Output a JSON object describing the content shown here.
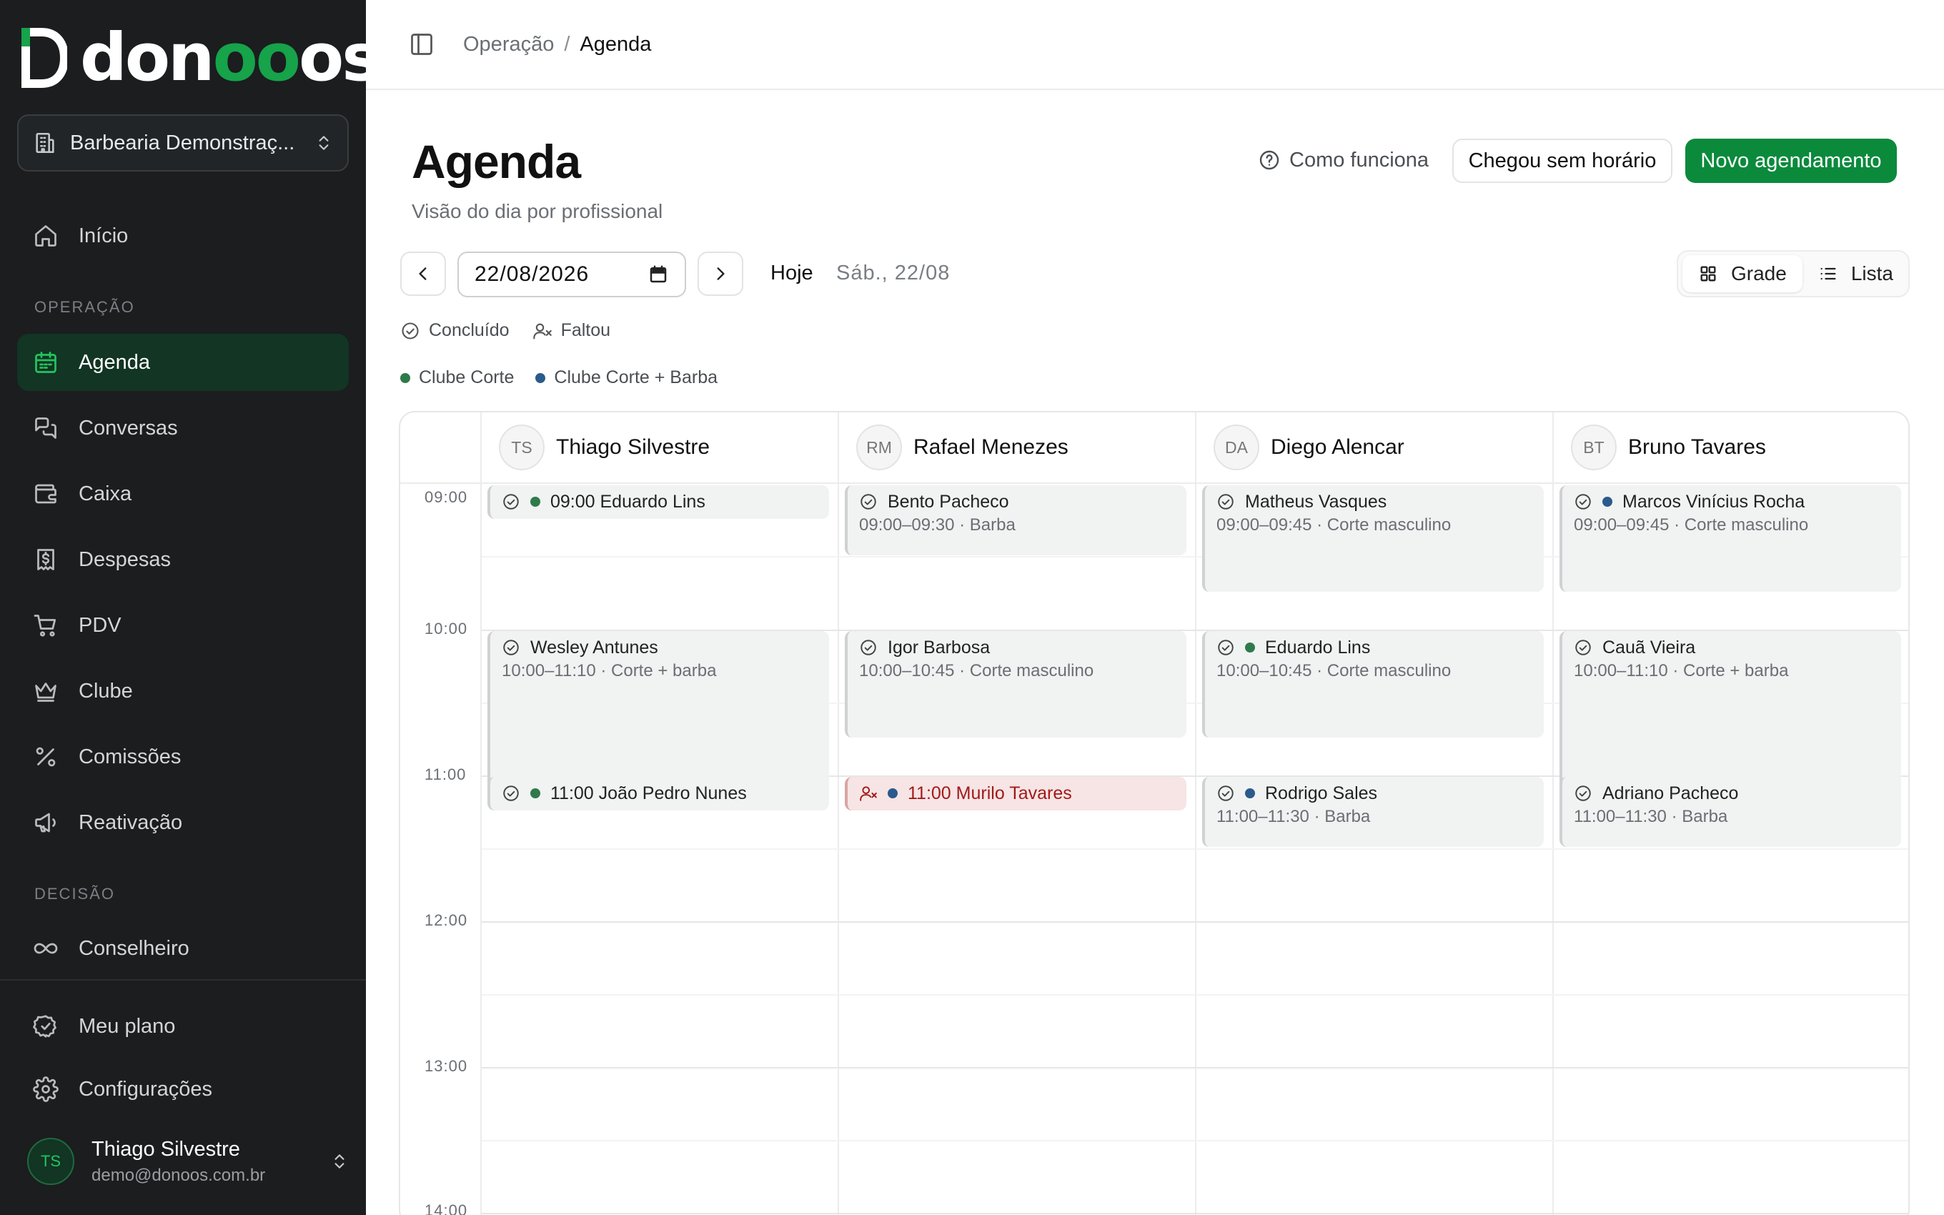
{
  "app": {
    "brand_prefix": "don",
    "brand_suffix": "os",
    "brand_accent": "oo",
    "brand_color": "#16a34a"
  },
  "sidebar": {
    "org_name": "Barbearia Demonstraç...",
    "items_top": [
      {
        "label": "Início",
        "icon": "home-icon"
      }
    ],
    "section_operacao": "OPERAÇÃO",
    "items_operacao": [
      {
        "label": "Agenda",
        "icon": "calendar-icon",
        "active": true
      },
      {
        "label": "Conversas",
        "icon": "chat-icon"
      },
      {
        "label": "Caixa",
        "icon": "wallet-icon"
      },
      {
        "label": "Despesas",
        "icon": "receipt-icon"
      },
      {
        "label": "PDV",
        "icon": "cart-icon"
      },
      {
        "label": "Clube",
        "icon": "crown-icon"
      },
      {
        "label": "Comissões",
        "icon": "percent-icon"
      },
      {
        "label": "Reativação",
        "icon": "megaphone-icon"
      }
    ],
    "section_decisao": "DECISÃO",
    "items_decisao": [
      {
        "label": "Conselheiro",
        "icon": "infinity-icon"
      }
    ],
    "items_bottom": [
      {
        "label": "Meu plano",
        "icon": "badge-check-icon"
      },
      {
        "label": "Configurações",
        "icon": "gear-icon"
      }
    ],
    "user": {
      "initials": "TS",
      "name": "Thiago Silvestre",
      "email": "demo@donoos.com.br"
    }
  },
  "breadcrumb": {
    "parent": "Operação",
    "separator": "/",
    "current": "Agenda"
  },
  "header": {
    "title": "Agenda",
    "subtitle": "Visão do dia por profissional",
    "how_label": "Como funciona",
    "walkin_label": "Chegou sem horário",
    "new_label": "Novo agendamento"
  },
  "toolbar": {
    "date_value": "22/08/2026",
    "today_label": "Hoje",
    "date_label": "Sáb., 22/08",
    "views": [
      {
        "label": "Grade",
        "icon": "grid-icon",
        "selected": true
      },
      {
        "label": "Lista",
        "icon": "list-icon",
        "selected": false
      }
    ]
  },
  "legend": {
    "status": [
      {
        "label": "Concluído",
        "icon": "check-circle-icon"
      },
      {
        "label": "Faltou",
        "icon": "user-x-icon"
      }
    ],
    "plans": [
      {
        "label": "Clube Corte",
        "color": "#2f7a4a"
      },
      {
        "label": "Clube Corte + Barba",
        "color": "#2b5a8c"
      }
    ]
  },
  "calendar": {
    "hours": [
      "09:00",
      "10:00",
      "11:00",
      "12:00",
      "13:00",
      "14:00"
    ],
    "professionals": [
      {
        "initials": "TS",
        "name": "Thiago Silvestre"
      },
      {
        "initials": "RM",
        "name": "Rafael Menezes"
      },
      {
        "initials": "DA",
        "name": "Diego Alencar"
      },
      {
        "initials": "BT",
        "name": "Bruno Tavares"
      }
    ],
    "appointments": [
      {
        "col": 0,
        "start": "09:00",
        "end": "09:15",
        "title": "09:00 Eduardo Lins",
        "detail": "",
        "status": "done",
        "plan": "Clube Corte"
      },
      {
        "col": 0,
        "start": "10:00",
        "end": "11:10",
        "title": "Wesley Antunes",
        "detail": "10:00–11:10 · Corte + barba",
        "status": "done",
        "plan": ""
      },
      {
        "col": 0,
        "start": "11:00",
        "end": "11:15",
        "title": "11:00 João Pedro Nunes",
        "detail": "",
        "status": "done",
        "plan": "Clube Corte"
      },
      {
        "col": 1,
        "start": "09:00",
        "end": "09:30",
        "title": "Bento Pacheco",
        "detail": "09:00–09:30 · Barba",
        "status": "done",
        "plan": ""
      },
      {
        "col": 1,
        "start": "10:00",
        "end": "10:45",
        "title": "Igor Barbosa",
        "detail": "10:00–10:45 · Corte masculino",
        "status": "done",
        "plan": ""
      },
      {
        "col": 1,
        "start": "11:00",
        "end": "11:15",
        "title": "11:00 Murilo Tavares",
        "detail": "",
        "status": "missed",
        "plan": "Clube Corte + Barba"
      },
      {
        "col": 2,
        "start": "09:00",
        "end": "09:45",
        "title": "Matheus Vasques",
        "detail": "09:00–09:45 · Corte masculino",
        "status": "done",
        "plan": ""
      },
      {
        "col": 2,
        "start": "10:00",
        "end": "10:45",
        "title": "Eduardo Lins",
        "detail": "10:00–10:45 · Corte masculino",
        "status": "done",
        "plan": "Clube Corte"
      },
      {
        "col": 2,
        "start": "11:00",
        "end": "11:30",
        "title": "Rodrigo Sales",
        "detail": "11:00–11:30 · Barba",
        "status": "done",
        "plan": "Clube Corte + Barba"
      },
      {
        "col": 3,
        "start": "09:00",
        "end": "09:45",
        "title": "Marcos Vinícius Rocha",
        "detail": "09:00–09:45 · Corte masculino",
        "status": "done",
        "plan": "Clube Corte + Barba"
      },
      {
        "col": 3,
        "start": "10:00",
        "end": "11:10",
        "title": "Cauã Vieira",
        "detail": "10:00–11:10 · Corte + barba",
        "status": "done",
        "plan": ""
      },
      {
        "col": 3,
        "start": "11:00",
        "end": "11:30",
        "title": "Adriano Pacheco",
        "detail": "11:00–11:30 · Barba",
        "status": "done",
        "plan": ""
      }
    ]
  }
}
